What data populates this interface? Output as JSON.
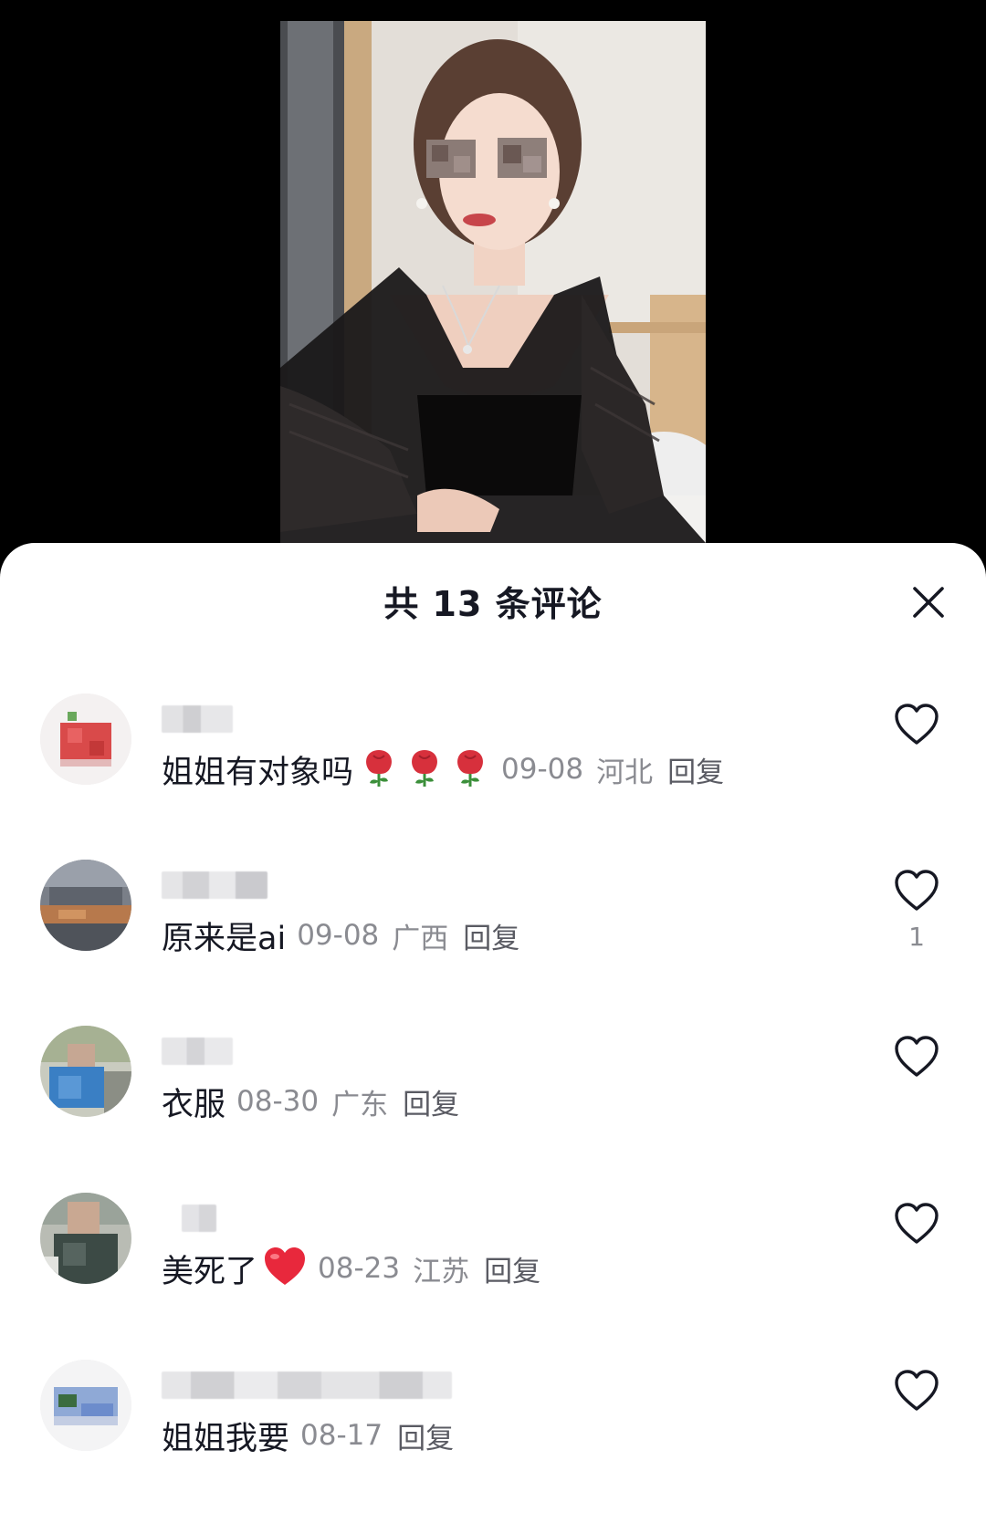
{
  "video": {
    "background": "#000000"
  },
  "sheet": {
    "title": "共 13 条评论",
    "close_icon": "close-icon"
  },
  "comments": [
    {
      "text": "姐姐有对象吗",
      "emojis": [
        "rose-emoji",
        "rose-emoji",
        "rose-emoji"
      ],
      "date": "09-08",
      "location": "河北",
      "reply": "回复",
      "likes": ""
    },
    {
      "text": "原来是ai",
      "emojis": [],
      "date": "09-08",
      "location": "广西",
      "reply": "回复",
      "likes": "1"
    },
    {
      "text": "衣服",
      "emojis": [],
      "date": "08-30",
      "location": "广东",
      "reply": "回复",
      "likes": ""
    },
    {
      "text": "美死了",
      "emojis": [
        "red-heart-emoji"
      ],
      "date": "08-23",
      "location": "江苏",
      "reply": "回复",
      "likes": ""
    },
    {
      "text": "姐姐我要",
      "emojis": [],
      "date": "08-17",
      "location": "",
      "reply": "回复",
      "likes": ""
    }
  ],
  "colors": {
    "primary_text": "#161823",
    "secondary_text": "#8a8b91",
    "sheet_background": "#ffffff"
  }
}
